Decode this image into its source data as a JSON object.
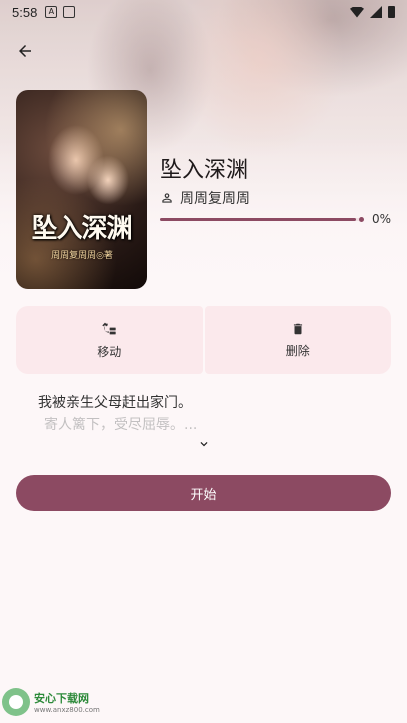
{
  "status_bar": {
    "time": "5:58"
  },
  "book": {
    "title": "坠入深渊",
    "author": "周周复周周",
    "cover_title": "坠入深渊",
    "cover_author": "周周复周周◎著",
    "progress_text": "0%",
    "progress_value": 0.97
  },
  "actions": {
    "move_label": "移动",
    "delete_label": "删除"
  },
  "synopsis": {
    "line1": "我被亲生父母赶出家门。",
    "line2": "寄人篱下，受尽屈辱。..."
  },
  "start_button": {
    "label": "开始"
  },
  "watermark": {
    "name": "安心下载网",
    "url": "www.anxz800.com"
  },
  "colors": {
    "accent": "#8c4a62",
    "action_bg": "#fbe9ec"
  },
  "icons": {
    "back": "arrow-left-icon",
    "person": "person-icon",
    "move": "move-icon",
    "delete": "trash-icon",
    "expand": "chevron-down-icon"
  }
}
